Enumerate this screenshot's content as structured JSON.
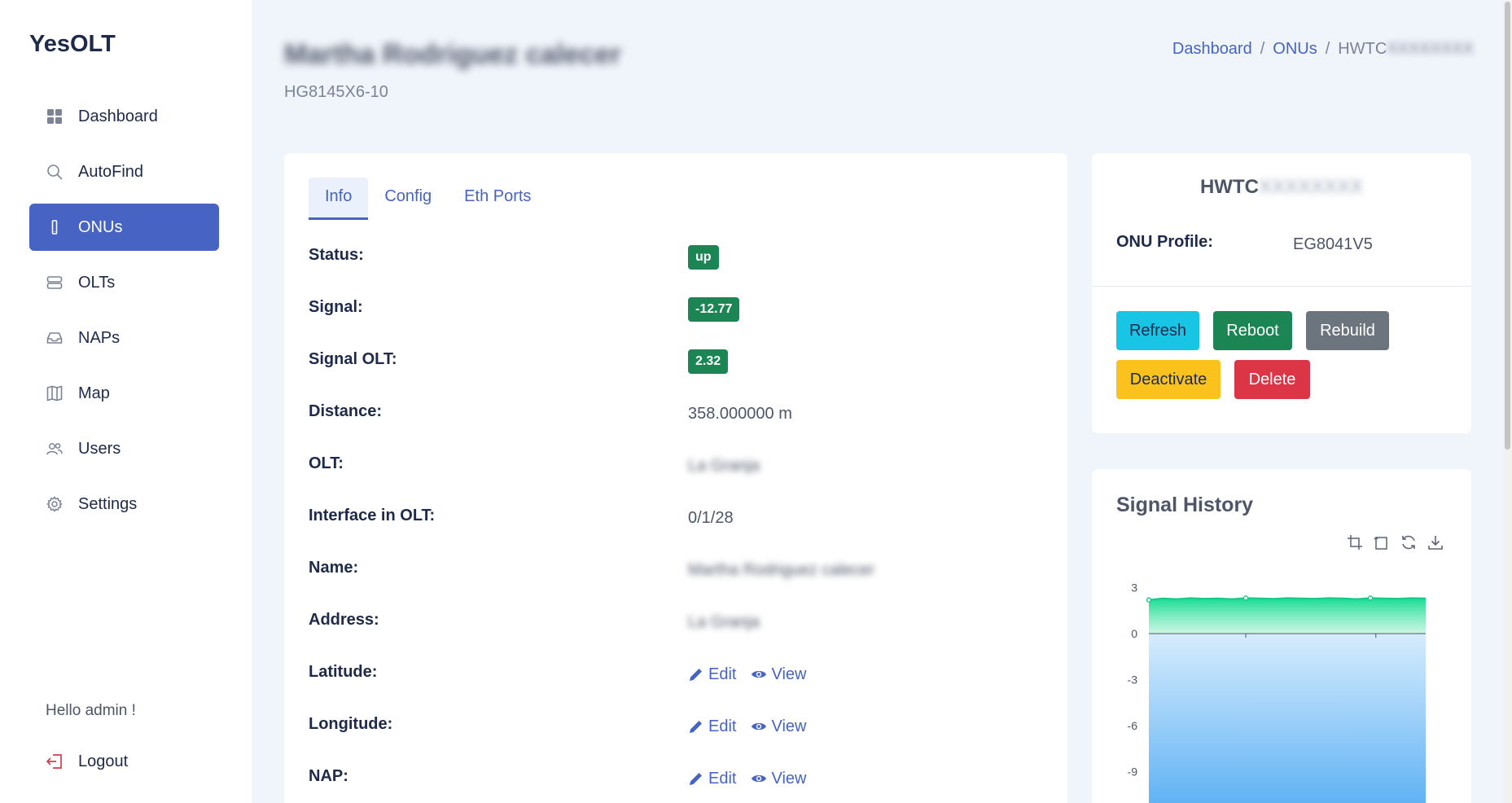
{
  "brand": "YesOLT",
  "sidebar": {
    "items": [
      {
        "label": "Dashboard",
        "icon": "dashboard-icon"
      },
      {
        "label": "AutoFind",
        "icon": "search-icon"
      },
      {
        "label": "ONUs",
        "icon": "onu-icon",
        "active": true
      },
      {
        "label": "OLTs",
        "icon": "server-icon"
      },
      {
        "label": "NAPs",
        "icon": "inbox-icon"
      },
      {
        "label": "Map",
        "icon": "map-icon"
      },
      {
        "label": "Users",
        "icon": "users-icon"
      },
      {
        "label": "Settings",
        "icon": "gear-icon"
      }
    ],
    "greeting": "Hello admin !",
    "logout": "Logout"
  },
  "header": {
    "title": "Martha Rodriguez calecer",
    "subtitle": "HG8145X6-10",
    "breadcrumb": [
      "Dashboard",
      "ONUs",
      "HWTC"
    ],
    "breadcrumb_sep": "/"
  },
  "tabs": [
    {
      "label": "Info",
      "active": true
    },
    {
      "label": "Config"
    },
    {
      "label": "Eth Ports"
    }
  ],
  "info": {
    "status_label": "Status:",
    "status_value": "up",
    "signal_label": "Signal:",
    "signal_value": "-12.77",
    "signal_olt_label": "Signal OLT:",
    "signal_olt_value": "2.32",
    "distance_label": "Distance:",
    "distance_value": "358.000000 m",
    "olt_label": "OLT:",
    "olt_value": "La Granja",
    "interface_label": "Interface in OLT:",
    "interface_value": "0/1/28",
    "name_label": "Name:",
    "name_value": "Martha Rodriguez calecer",
    "address_label": "Address:",
    "address_value": "La Granja",
    "latitude_label": "Latitude:",
    "longitude_label": "Longitude:",
    "nap_label": "NAP:",
    "edit_label": "Edit",
    "view_label": "View"
  },
  "device": {
    "serial": "HWTC",
    "profile_label": "ONU Profile:",
    "profile_value": "EG8041V5"
  },
  "actions": {
    "refresh": "Refresh",
    "reboot": "Reboot",
    "rebuild": "Rebuild",
    "deactivate": "Deactivate",
    "delete": "Delete"
  },
  "colors": {
    "accent": "#4763c3",
    "success": "#1b8654",
    "info": "#19c5e5",
    "secondary": "#6c757d",
    "warning": "#fbc11d",
    "danger": "#dc3545"
  },
  "chart_data": {
    "type": "area",
    "title": "Signal History",
    "xlabel": "",
    "ylabel": "",
    "ylim": [
      -12,
      3
    ],
    "yticks": [
      3,
      0,
      -3,
      -6,
      -9
    ],
    "grid": false,
    "series": [
      {
        "values": [
          2.2,
          2.3,
          2.25,
          2.32,
          2.28,
          2.3,
          2.25,
          2.32,
          2.3,
          2.27,
          2.32,
          2.3,
          2.28,
          2.32,
          2.3,
          2.25,
          2.32,
          2.3,
          2.28,
          2.32,
          2.3
        ]
      },
      {
        "values": [
          -12.77,
          -12.77,
          -12.77,
          -12.77,
          -12.77,
          -12.77,
          -12.77,
          -12.77,
          -12.77,
          -12.77,
          -12.77,
          -12.77,
          -12.77,
          -12.77,
          -12.77,
          -12.77,
          -12.77,
          -12.77,
          -12.77,
          -12.77,
          -12.77
        ]
      }
    ]
  }
}
